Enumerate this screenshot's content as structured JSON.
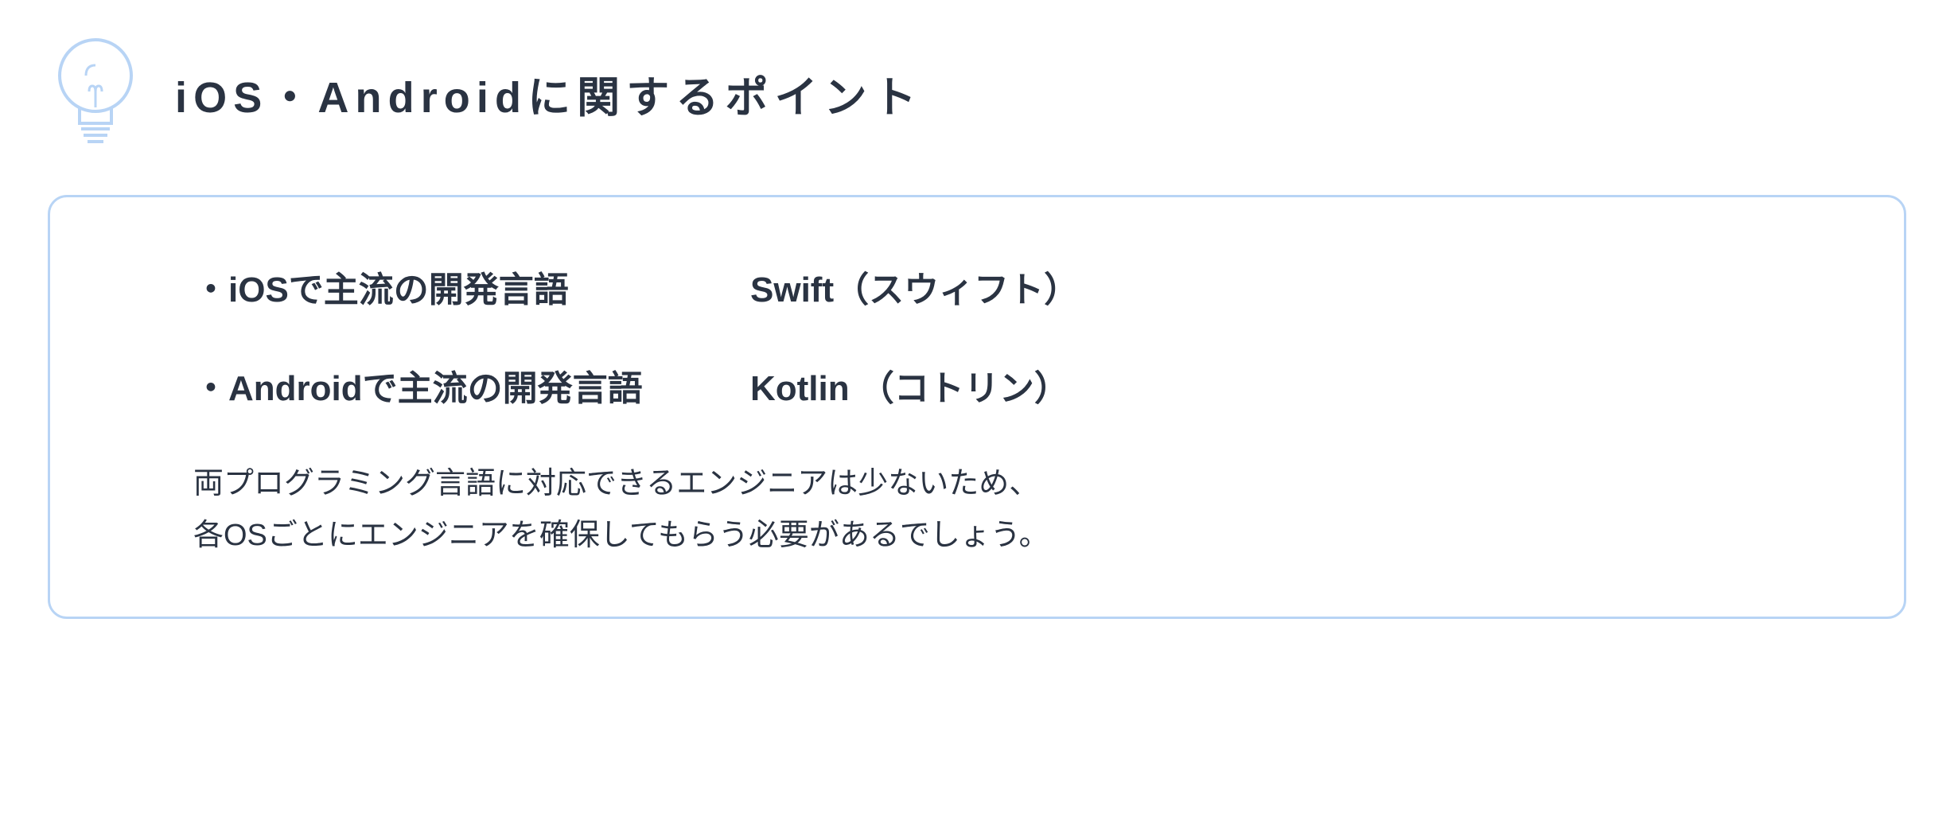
{
  "title": "iOS・Androidに関するポイント",
  "items": [
    {
      "label": "・iOSで主流の開発言語",
      "value": "Swift（スウィフト）"
    },
    {
      "label": "・Androidで主流の開発言語",
      "value": "Kotlin （コトリン）"
    }
  ],
  "description_line1": "両プログラミング言語に対応できるエンジニアは少ないため、",
  "description_line2": "各OSごとにエンジニアを確保してもらう必要があるでしょう。"
}
